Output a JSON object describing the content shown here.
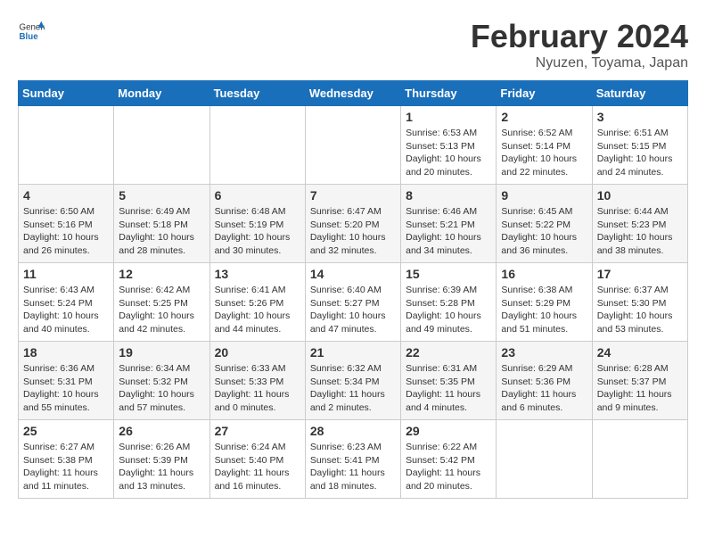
{
  "header": {
    "logo_general": "General",
    "logo_blue": "Blue",
    "month_title": "February 2024",
    "location": "Nyuzen, Toyama, Japan"
  },
  "weekdays": [
    "Sunday",
    "Monday",
    "Tuesday",
    "Wednesday",
    "Thursday",
    "Friday",
    "Saturday"
  ],
  "weeks": [
    [
      {
        "day": "",
        "info": ""
      },
      {
        "day": "",
        "info": ""
      },
      {
        "day": "",
        "info": ""
      },
      {
        "day": "",
        "info": ""
      },
      {
        "day": "1",
        "info": "Sunrise: 6:53 AM\nSunset: 5:13 PM\nDaylight: 10 hours\nand 20 minutes."
      },
      {
        "day": "2",
        "info": "Sunrise: 6:52 AM\nSunset: 5:14 PM\nDaylight: 10 hours\nand 22 minutes."
      },
      {
        "day": "3",
        "info": "Sunrise: 6:51 AM\nSunset: 5:15 PM\nDaylight: 10 hours\nand 24 minutes."
      }
    ],
    [
      {
        "day": "4",
        "info": "Sunrise: 6:50 AM\nSunset: 5:16 PM\nDaylight: 10 hours\nand 26 minutes."
      },
      {
        "day": "5",
        "info": "Sunrise: 6:49 AM\nSunset: 5:18 PM\nDaylight: 10 hours\nand 28 minutes."
      },
      {
        "day": "6",
        "info": "Sunrise: 6:48 AM\nSunset: 5:19 PM\nDaylight: 10 hours\nand 30 minutes."
      },
      {
        "day": "7",
        "info": "Sunrise: 6:47 AM\nSunset: 5:20 PM\nDaylight: 10 hours\nand 32 minutes."
      },
      {
        "day": "8",
        "info": "Sunrise: 6:46 AM\nSunset: 5:21 PM\nDaylight: 10 hours\nand 34 minutes."
      },
      {
        "day": "9",
        "info": "Sunrise: 6:45 AM\nSunset: 5:22 PM\nDaylight: 10 hours\nand 36 minutes."
      },
      {
        "day": "10",
        "info": "Sunrise: 6:44 AM\nSunset: 5:23 PM\nDaylight: 10 hours\nand 38 minutes."
      }
    ],
    [
      {
        "day": "11",
        "info": "Sunrise: 6:43 AM\nSunset: 5:24 PM\nDaylight: 10 hours\nand 40 minutes."
      },
      {
        "day": "12",
        "info": "Sunrise: 6:42 AM\nSunset: 5:25 PM\nDaylight: 10 hours\nand 42 minutes."
      },
      {
        "day": "13",
        "info": "Sunrise: 6:41 AM\nSunset: 5:26 PM\nDaylight: 10 hours\nand 44 minutes."
      },
      {
        "day": "14",
        "info": "Sunrise: 6:40 AM\nSunset: 5:27 PM\nDaylight: 10 hours\nand 47 minutes."
      },
      {
        "day": "15",
        "info": "Sunrise: 6:39 AM\nSunset: 5:28 PM\nDaylight: 10 hours\nand 49 minutes."
      },
      {
        "day": "16",
        "info": "Sunrise: 6:38 AM\nSunset: 5:29 PM\nDaylight: 10 hours\nand 51 minutes."
      },
      {
        "day": "17",
        "info": "Sunrise: 6:37 AM\nSunset: 5:30 PM\nDaylight: 10 hours\nand 53 minutes."
      }
    ],
    [
      {
        "day": "18",
        "info": "Sunrise: 6:36 AM\nSunset: 5:31 PM\nDaylight: 10 hours\nand 55 minutes."
      },
      {
        "day": "19",
        "info": "Sunrise: 6:34 AM\nSunset: 5:32 PM\nDaylight: 10 hours\nand 57 minutes."
      },
      {
        "day": "20",
        "info": "Sunrise: 6:33 AM\nSunset: 5:33 PM\nDaylight: 11 hours\nand 0 minutes."
      },
      {
        "day": "21",
        "info": "Sunrise: 6:32 AM\nSunset: 5:34 PM\nDaylight: 11 hours\nand 2 minutes."
      },
      {
        "day": "22",
        "info": "Sunrise: 6:31 AM\nSunset: 5:35 PM\nDaylight: 11 hours\nand 4 minutes."
      },
      {
        "day": "23",
        "info": "Sunrise: 6:29 AM\nSunset: 5:36 PM\nDaylight: 11 hours\nand 6 minutes."
      },
      {
        "day": "24",
        "info": "Sunrise: 6:28 AM\nSunset: 5:37 PM\nDaylight: 11 hours\nand 9 minutes."
      }
    ],
    [
      {
        "day": "25",
        "info": "Sunrise: 6:27 AM\nSunset: 5:38 PM\nDaylight: 11 hours\nand 11 minutes."
      },
      {
        "day": "26",
        "info": "Sunrise: 6:26 AM\nSunset: 5:39 PM\nDaylight: 11 hours\nand 13 minutes."
      },
      {
        "day": "27",
        "info": "Sunrise: 6:24 AM\nSunset: 5:40 PM\nDaylight: 11 hours\nand 16 minutes."
      },
      {
        "day": "28",
        "info": "Sunrise: 6:23 AM\nSunset: 5:41 PM\nDaylight: 11 hours\nand 18 minutes."
      },
      {
        "day": "29",
        "info": "Sunrise: 6:22 AM\nSunset: 5:42 PM\nDaylight: 11 hours\nand 20 minutes."
      },
      {
        "day": "",
        "info": ""
      },
      {
        "day": "",
        "info": ""
      }
    ]
  ]
}
